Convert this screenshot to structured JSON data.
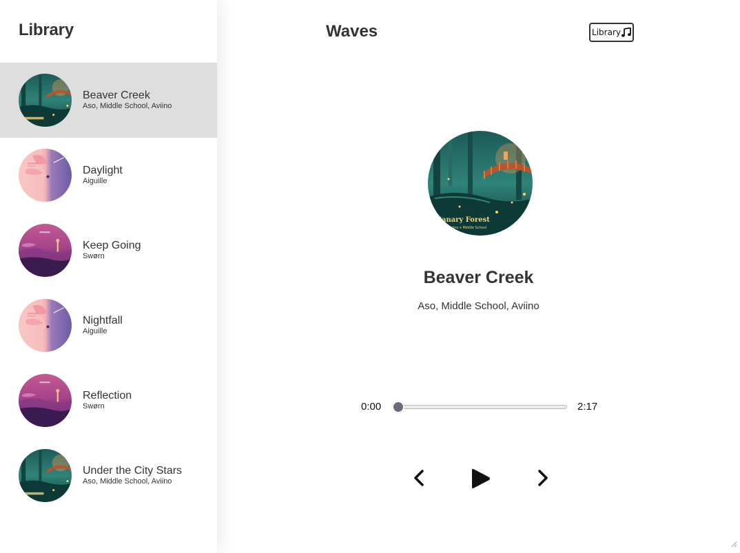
{
  "sidebar": {
    "title": "Library",
    "songs": [
      {
        "name": "Beaver Creek",
        "artist": "Aso, Middle School, Aviino",
        "active": true,
        "cover": "forest"
      },
      {
        "name": "Daylight",
        "artist": "Aiguille",
        "active": false,
        "cover": "pink"
      },
      {
        "name": "Keep Going",
        "artist": "Swørn",
        "active": false,
        "cover": "magenta"
      },
      {
        "name": "Nightfall",
        "artist": "Aiguille",
        "active": false,
        "cover": "pink"
      },
      {
        "name": "Reflection",
        "artist": "Swørn",
        "active": false,
        "cover": "magenta"
      },
      {
        "name": "Under the City Stars",
        "artist": "Aso, Middle School, Aviino",
        "active": false,
        "cover": "forest"
      }
    ]
  },
  "header": {
    "title": "Waves",
    "library_button_label": "Library",
    "library_button_icon": "music-note-icon"
  },
  "player": {
    "track_title": "Beaver Creek",
    "track_artist": "Aso, Middle School, Aviino",
    "cover_text": "Canary Forest",
    "cover_subtext": "Aso x Aviino x Middle School",
    "current_time": "0:00",
    "duration": "2:17",
    "progress": 0,
    "controls": {
      "previous_icon": "chevron-left-icon",
      "play_icon": "play-icon",
      "next_icon": "chevron-right-icon"
    }
  },
  "colors": {
    "text": "#333333",
    "active_row": "#dedede",
    "seek_thumb": "#6b6b7a"
  }
}
